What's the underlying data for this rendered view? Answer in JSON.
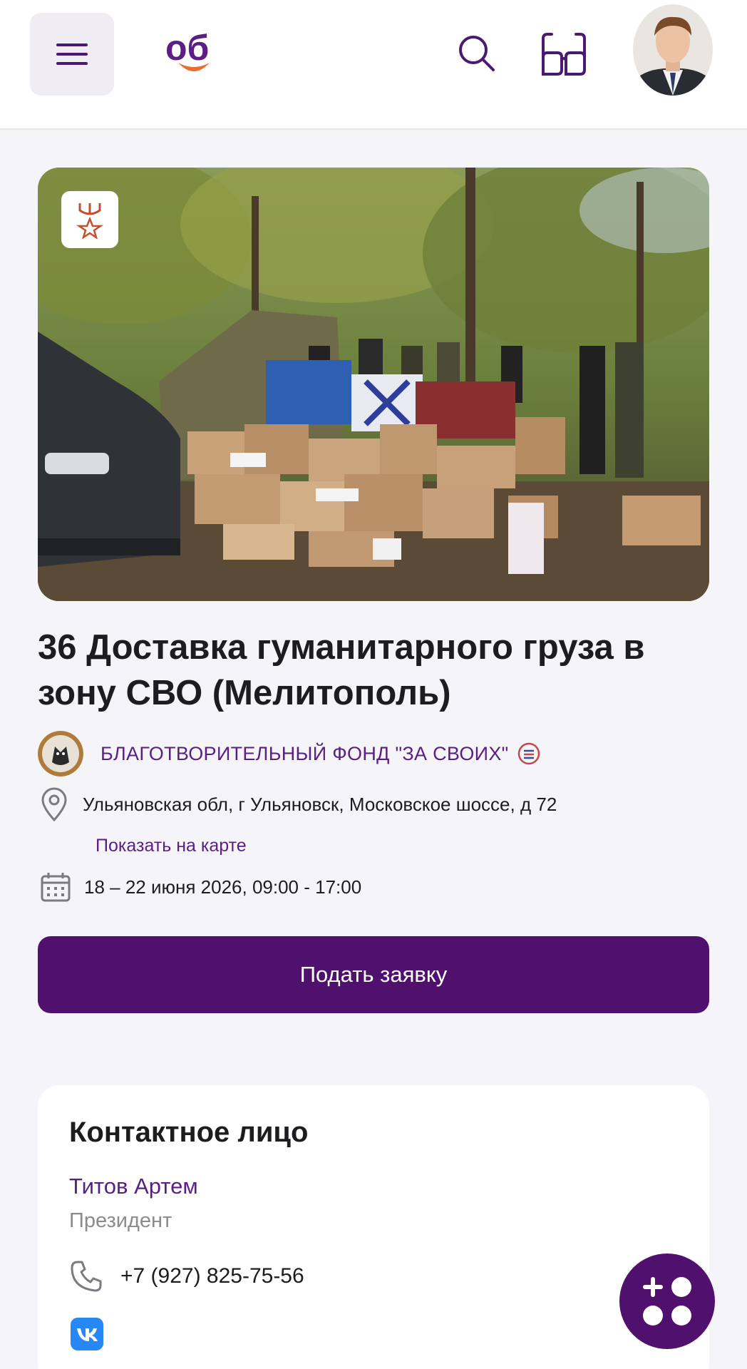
{
  "header": {
    "logo_text": "об",
    "icons": [
      "menu-icon",
      "search-icon",
      "glasses-icon"
    ]
  },
  "event": {
    "title": "36 Доставка гуманитарного груза в зону СВО (Мелитополь)",
    "organizer": "БЛАГОТВОРИТЕЛЬНЫЙ ФОНД \"ЗА СВОИХ\"",
    "address": "Ульяновская обл, г Ульяновск, Московское шоссе, д 72",
    "map_link": "Показать на карте",
    "dates": "18 – 22 июня 2026, 09:00 - 17:00",
    "apply_label": "Подать заявку"
  },
  "contact": {
    "section_title": "Контактное лицо",
    "name": "Титов Артем",
    "role": "Президент",
    "phone": "+7 (927) 825-75-56"
  },
  "colors": {
    "brand": "#4f106e",
    "link": "#5a1e85",
    "accent_orange": "#ef6b2c"
  }
}
